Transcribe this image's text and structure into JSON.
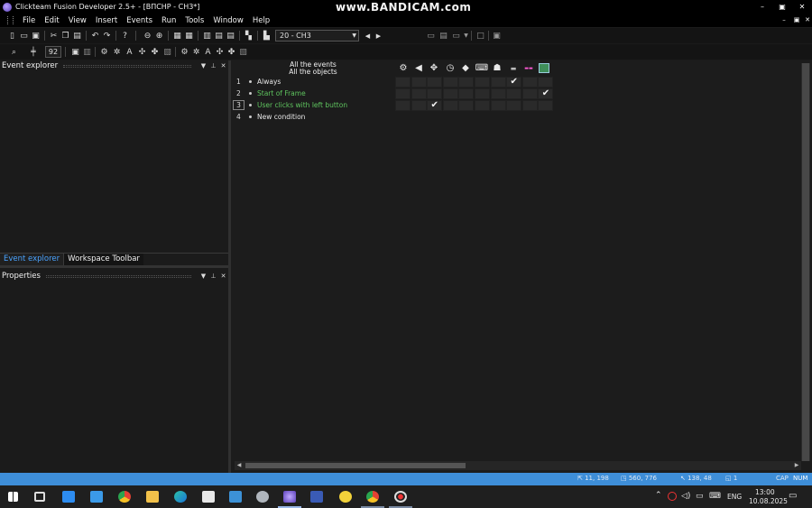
{
  "window": {
    "title": "Clickteam Fusion Developer 2.5+ - [ВПСНР - СН3*]",
    "watermark": "www.BANDICAM.com",
    "controls": {
      "minimize": "–",
      "maximize": "▣",
      "close": "✕"
    }
  },
  "menu": {
    "items": [
      "File",
      "Edit",
      "View",
      "Insert",
      "Events",
      "Run",
      "Tools",
      "Window",
      "Help"
    ],
    "mdi_controls": {
      "minimize": "–",
      "restore": "▣",
      "close": "✕"
    }
  },
  "toolbar": {
    "frame_select_value": "20 - СН3",
    "zoom_value": "92"
  },
  "panels": {
    "event_explorer": {
      "title": "Event explorer"
    },
    "properties": {
      "title": "Properties"
    },
    "tabs": [
      {
        "label": "Event explorer",
        "active": true
      },
      {
        "label": "Workspace Toolbar",
        "active": false
      }
    ]
  },
  "event_editor": {
    "header_line1": "All the events",
    "header_line2": "All the objects",
    "rows": [
      {
        "number": "1",
        "label": "Always",
        "color": "white"
      },
      {
        "number": "2",
        "label": "Start of Frame",
        "color": "green"
      },
      {
        "number": "3",
        "label": "User clicks with left button",
        "color": "green"
      },
      {
        "number": "4",
        "label": "New condition",
        "color": "white"
      }
    ],
    "checks": [
      {
        "row": 0,
        "col": 7
      },
      {
        "row": 1,
        "col": 9
      },
      {
        "row": 2,
        "col": 2
      }
    ]
  },
  "statusbar": {
    "items": [
      "⇱ 11, 198",
      "◳ 560, 776",
      "↖ 138, 48",
      "◱ 1",
      "CAP",
      "NUM"
    ]
  },
  "taskbar": {
    "lang": "ENG",
    "time": "13:00",
    "date": "10.08.2025"
  }
}
